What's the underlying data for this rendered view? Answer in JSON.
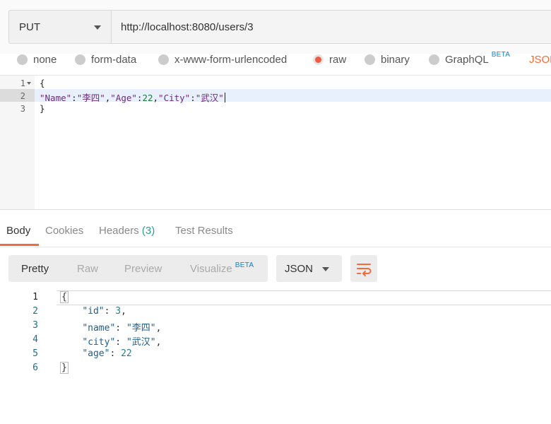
{
  "request": {
    "method": "PUT",
    "url": "http://localhost:8080/users/3"
  },
  "body_types": [
    {
      "label": "none",
      "selected": false
    },
    {
      "label": "form-data",
      "selected": false
    },
    {
      "label": "x-www-form-urlencoded",
      "selected": false
    },
    {
      "label": "raw",
      "selected": true
    },
    {
      "label": "binary",
      "selected": false
    },
    {
      "label": "GraphQL",
      "selected": false,
      "badge": "BETA"
    }
  ],
  "raw_format": "JSON",
  "request_editor": {
    "line_numbers": [
      "1",
      "2",
      "3"
    ],
    "line1": "{",
    "line2": {
      "k1": "\"Name\"",
      "v1": "\"李四\"",
      "k2": "\"Age\"",
      "v2": "22",
      "k3": "\"City\"",
      "v3": "\"武汉\""
    },
    "line3": "}"
  },
  "response_tabs": {
    "body": "Body",
    "cookies": "Cookies",
    "headers": "Headers",
    "headers_count": "(3)",
    "test_results": "Test Results"
  },
  "response_toolbar": {
    "pretty": "Pretty",
    "raw": "Raw",
    "preview": "Preview",
    "visualize": "Visualize",
    "visualize_badge": "BETA",
    "format": "JSON"
  },
  "response_body": {
    "line_numbers": [
      "1",
      "2",
      "3",
      "4",
      "5",
      "6"
    ],
    "open": "{",
    "id_key": "\"id\"",
    "id_val": "3",
    "name_key": "\"name\"",
    "name_val": "\"李四\"",
    "city_key": "\"city\"",
    "city_val": "\"武汉\"",
    "age_key": "\"age\"",
    "age_val": "22",
    "close": "}"
  },
  "colors": {
    "accent": "#f26b3a",
    "radio_selected": "#ef5b43",
    "beta": "#0b84d8",
    "header_count": "#2a9d8f"
  }
}
